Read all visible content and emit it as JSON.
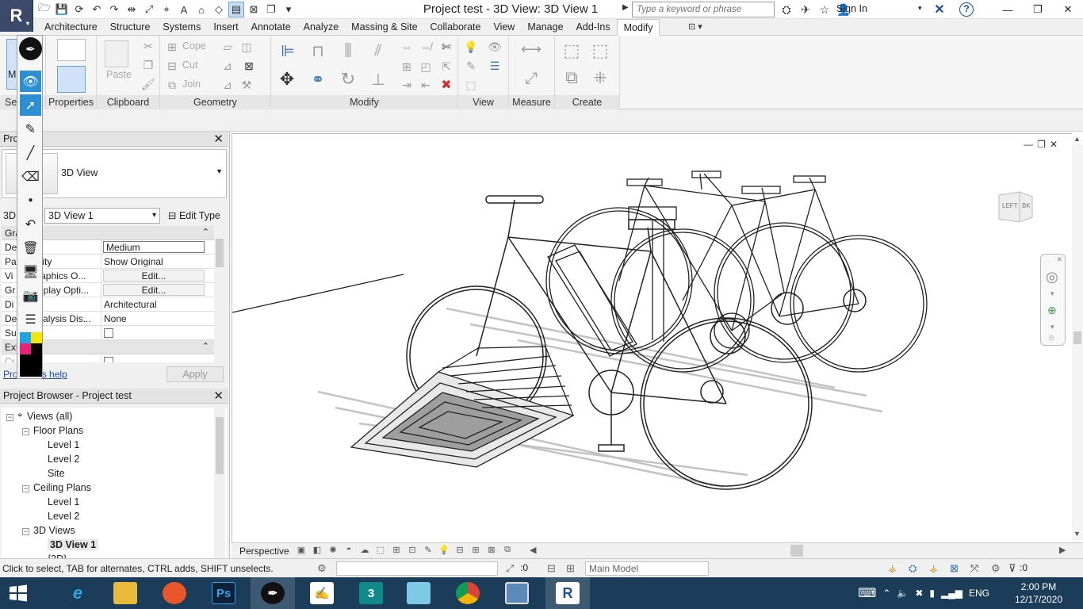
{
  "window": {
    "title": "Project test - 3D View: 3D View 1",
    "search_placeholder": "Type a keyword or phrase",
    "sign_in": "Sign In",
    "app_letter": "R"
  },
  "ribbon": {
    "tabs": [
      "Architecture",
      "Structure",
      "Systems",
      "Insert",
      "Annotate",
      "Analyze",
      "Massing & Site",
      "Collaborate",
      "View",
      "Manage",
      "Add-Ins",
      "Modify"
    ],
    "active_tab": "Modify",
    "panels": {
      "select": "Sel",
      "properties": "Properties",
      "clipboard": "Clipboard",
      "geometry": "Geometry",
      "modify": "Modify",
      "view": "View",
      "measure": "Measure",
      "create": "Create"
    },
    "buttons": {
      "modify_short": "M",
      "paste": "Paste",
      "cope": "Cope",
      "cut": "Cut",
      "join": "Join"
    }
  },
  "properties": {
    "header": "Pro",
    "type_name": "3D View",
    "instance_prefix": "3D",
    "instance_value": "3D View 1",
    "edit_type": "Edit Type",
    "group_graphics": "Gra",
    "group_extents": "Exte",
    "rows": [
      {
        "key": "De",
        "key2": "vel",
        "value": "Medium",
        "kind": "boxed"
      },
      {
        "key": "Pa",
        "key2": "ibility",
        "value": "Show Original",
        "kind": "text"
      },
      {
        "key": "Vi",
        "key2": "/Graphics O...",
        "value": "Edit...",
        "kind": "button"
      },
      {
        "key": "Gr",
        "key2": "Display Opti...",
        "value": "Edit...",
        "kind": "button"
      },
      {
        "key": "Di",
        "key2": "e",
        "value": "Architectural",
        "kind": "text"
      },
      {
        "key": "De",
        "key2": "Analysis Dis...",
        "value": "None",
        "kind": "text"
      },
      {
        "key": "Su",
        "key2": "",
        "value": "",
        "kind": "checkbox"
      }
    ],
    "partial_row": "Cr",
    "partial_row2": "w",
    "help_link": "Pro",
    "help_link2": "s help",
    "apply": "Apply"
  },
  "browser": {
    "header": "Project Browser - Project test",
    "items": [
      {
        "label": "Views (all)",
        "level": 0,
        "toggle": "−"
      },
      {
        "label": "Floor Plans",
        "level": 1,
        "toggle": "−"
      },
      {
        "label": "Level 1",
        "level": 2
      },
      {
        "label": "Level 2",
        "level": 2
      },
      {
        "label": "Site",
        "level": 2
      },
      {
        "label": "Ceiling Plans",
        "level": 1,
        "toggle": "−"
      },
      {
        "label": "Level 1",
        "level": 2
      },
      {
        "label": "Level 2",
        "level": 2
      },
      {
        "label": "3D Views",
        "level": 1,
        "toggle": "−"
      },
      {
        "label": "3D View 1",
        "level": 2,
        "selected": true
      },
      {
        "label": "{3D}",
        "level": 2
      }
    ]
  },
  "viewport": {
    "view_style": "Perspective",
    "viewcube_left": "LEFT",
    "viewcube_back": "BK"
  },
  "status": {
    "text": "Click to select, TAB for alternates, CTRL adds, SHIFT unselects.",
    "count_left": ":0",
    "model": "Main Model",
    "filter_count": ":0"
  },
  "taskbar": {
    "time": "2:00 PM",
    "date": "12/17/2020",
    "lang": "ENG",
    "apps": [
      "e",
      "folder",
      "firefox",
      "Ps",
      "pen",
      "sign",
      "3",
      "prism",
      "chrome",
      "photos",
      "R"
    ]
  },
  "colors": {
    "accent": "#2c8fd4",
    "ribbon_bg": "#f5f5f5",
    "taskbar": "#1c3d5a",
    "app_button": "#3b4a6b"
  }
}
